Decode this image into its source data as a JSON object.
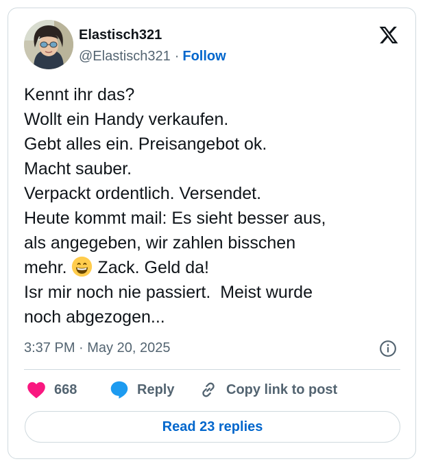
{
  "author": {
    "display_name": "Elastisch321",
    "handle": "@Elastisch321",
    "separator": "·",
    "follow_label": "Follow"
  },
  "brand_icon": "x-logo-icon",
  "tweet": {
    "lines_before_emoji": "Kennt ihr das?\nWollt ein Handy verkaufen.\nGebt alles ein. Preisangebot ok.\nMacht sauber.\nVerpackt ordentlich. Versendet.\nHeute kommt mail: Es sieht besser aus,\nals angegeben, wir zahlen bisschen\nmehr. ",
    "emoji": "grinning-face-emoji",
    "lines_after_emoji": " Zack. Geld da!\nIsr mir noch nie passiert.  Meist wurde\nnoch abgezogen..."
  },
  "meta": {
    "timestamp": "3:37 PM · May 20, 2025",
    "info_icon": "info-icon"
  },
  "actions": {
    "like": {
      "icon": "heart-icon",
      "count": "668"
    },
    "reply": {
      "icon": "speech-bubble-icon",
      "label": "Reply"
    },
    "copy": {
      "icon": "link-icon",
      "label": "Copy link to post"
    }
  },
  "read_replies_label": "Read 23 replies",
  "colors": {
    "link_blue": "#0066cc",
    "heart_pink": "#f91880",
    "reply_blue": "#1d9bf0",
    "muted_text": "#536471",
    "border": "#cfd9de"
  }
}
